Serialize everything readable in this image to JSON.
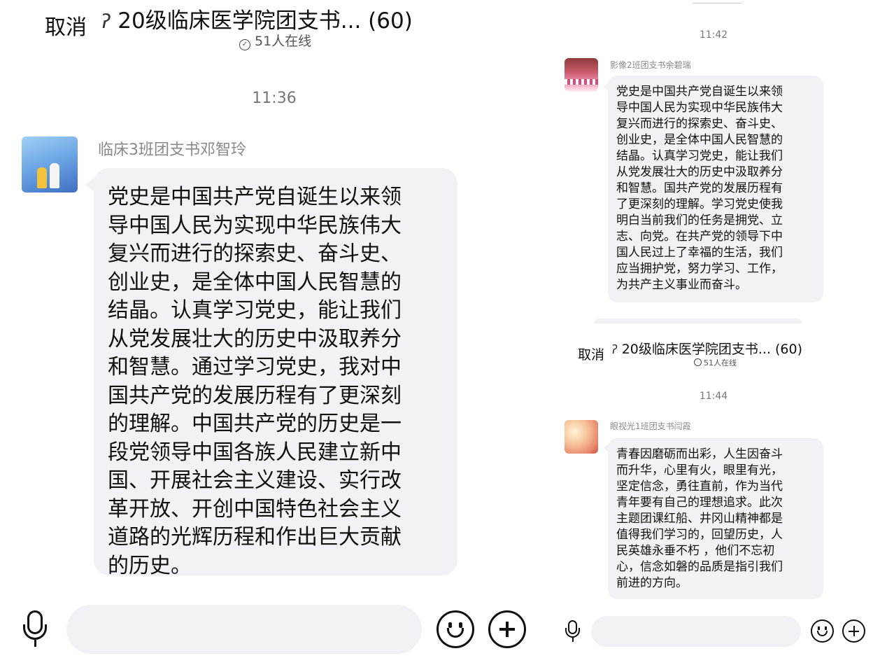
{
  "left": {
    "cancel": "取消",
    "title": "20级临床医学院团支书... (60)",
    "online": "51人在线",
    "time": "11:36",
    "sender": "临床3班团支书邓智玲",
    "message": "党史是中国共产党自诞生以来领\n导中国人民为实现中华民族伟大\n复兴而进行的探索史、奋斗史、\n创业史，是全体中国人民智慧的\n结晶。认真学习党史，能让我们\n从党发展壮大的历史中汲取养分\n和智慧。通过学习党史，我对中\n国共产党的发展历程有了更深刻\n的理解。中国共产党的历史是一\n段党领导中国各族人民建立新中\n国、开展社会主义建设、实行改\n革开放、开创中国特色社会主义\n道路的光辉历程和作出巨大贡献\n的历史。"
  },
  "right_top": {
    "time": "11:42",
    "sender": "影像2班团支书余碧瑞",
    "message": "党史是中国共产党自诞生以来领\n导中国人民为实现中华民族伟大\n复兴而进行的探索史、奋斗史、\n创业史，是全体中国人民智慧的\n结晶。认真学习党史，能让我们\n从党发展壮大的历史中汲取养分\n和智慧。国共产党的发展历程有\n了更深刻的理解。学习党史使我\n明白当前我们的任务是拥党、立\n志、向党。在共产党的领导下中\n国人民过上了幸福的生活，我们\n应当拥护党，努力学习、工作，\n为共产主义事业而奋斗。"
  },
  "right_bottom": {
    "cancel": "取消",
    "title": "20级临床医学院团支书... (60)",
    "online": "51人在线",
    "time": "11:44",
    "sender": "眼视光1班团支书闫霞",
    "message": "青春因磨砺而出彩，人生因奋斗\n而升华，心里有火，眼里有光，\n坚定信念，勇往直前，作为当代\n青年要有自己的理想追求。此次\n主题团课红船、井冈山精神都是\n值得我们学习的，回望历史，人\n民英雄永垂不朽 ，他们不忘初\n心，信念如磐的品质是指引我们\n前进的方向。"
  },
  "icons": {
    "ear": "ear-icon",
    "online": "online-status-icon",
    "mic": "microphone-icon",
    "emoji": "emoji-icon",
    "plus": "plus-icon"
  },
  "colors": {
    "bubble": "#f1f1f6",
    "background": "#ffffff",
    "secondary_text": "#8a8a8a"
  }
}
